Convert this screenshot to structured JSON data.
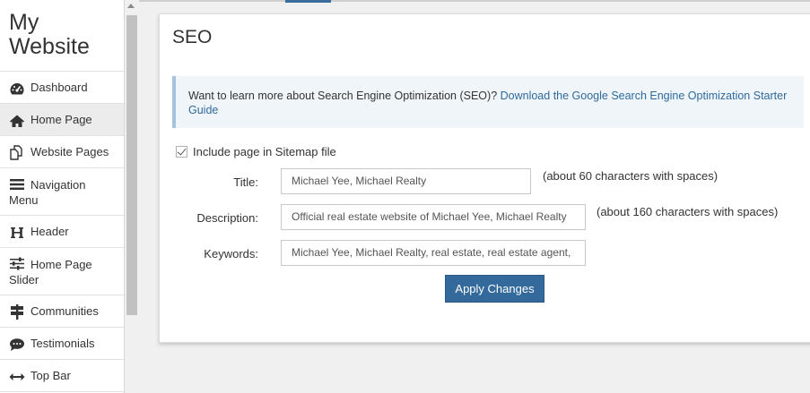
{
  "sidebar": {
    "site_title": "My Website",
    "items": [
      {
        "label": "Dashboard",
        "icon": "dashboard-icon"
      },
      {
        "label": "Home Page",
        "icon": "home-icon"
      },
      {
        "label": "Website Pages",
        "icon": "pages-icon"
      },
      {
        "label": "Navigation Menu",
        "icon": "menu-icon"
      },
      {
        "label": "Header",
        "icon": "header-icon"
      },
      {
        "label": "Home Page Slider",
        "icon": "sliders-icon"
      },
      {
        "label": "Communities",
        "icon": "signpost-icon"
      },
      {
        "label": "Testimonials",
        "icon": "comment-icon"
      },
      {
        "label": "Top Bar",
        "icon": "arrows-horizontal-icon"
      }
    ],
    "active_item": "Home Page"
  },
  "seo": {
    "title": "SEO",
    "alert_text": "Want to learn more about Search Engine Optimization (SEO)? ",
    "alert_link": "Download the Google Search Engine Optimization Starter Guide",
    "sitemap_label": "Include page in Sitemap file",
    "sitemap_checked": true,
    "fields": {
      "title_label": "Title:",
      "title_value": "Michael Yee, Michael Realty",
      "title_hint": "(about 60 characters with spaces)",
      "description_label": "Description:",
      "description_value": "Official real estate website of Michael Yee, Michael Realty",
      "description_hint": "(about 160 characters with spaces)",
      "keywords_label": "Keywords:",
      "keywords_value": "Michael Yee, Michael Realty, real estate, real estate agent,"
    },
    "apply_label": "Apply Changes"
  },
  "colors": {
    "accent": "#336a9b",
    "link": "#2f6a9b",
    "alert_bg": "#f0f5fa"
  }
}
